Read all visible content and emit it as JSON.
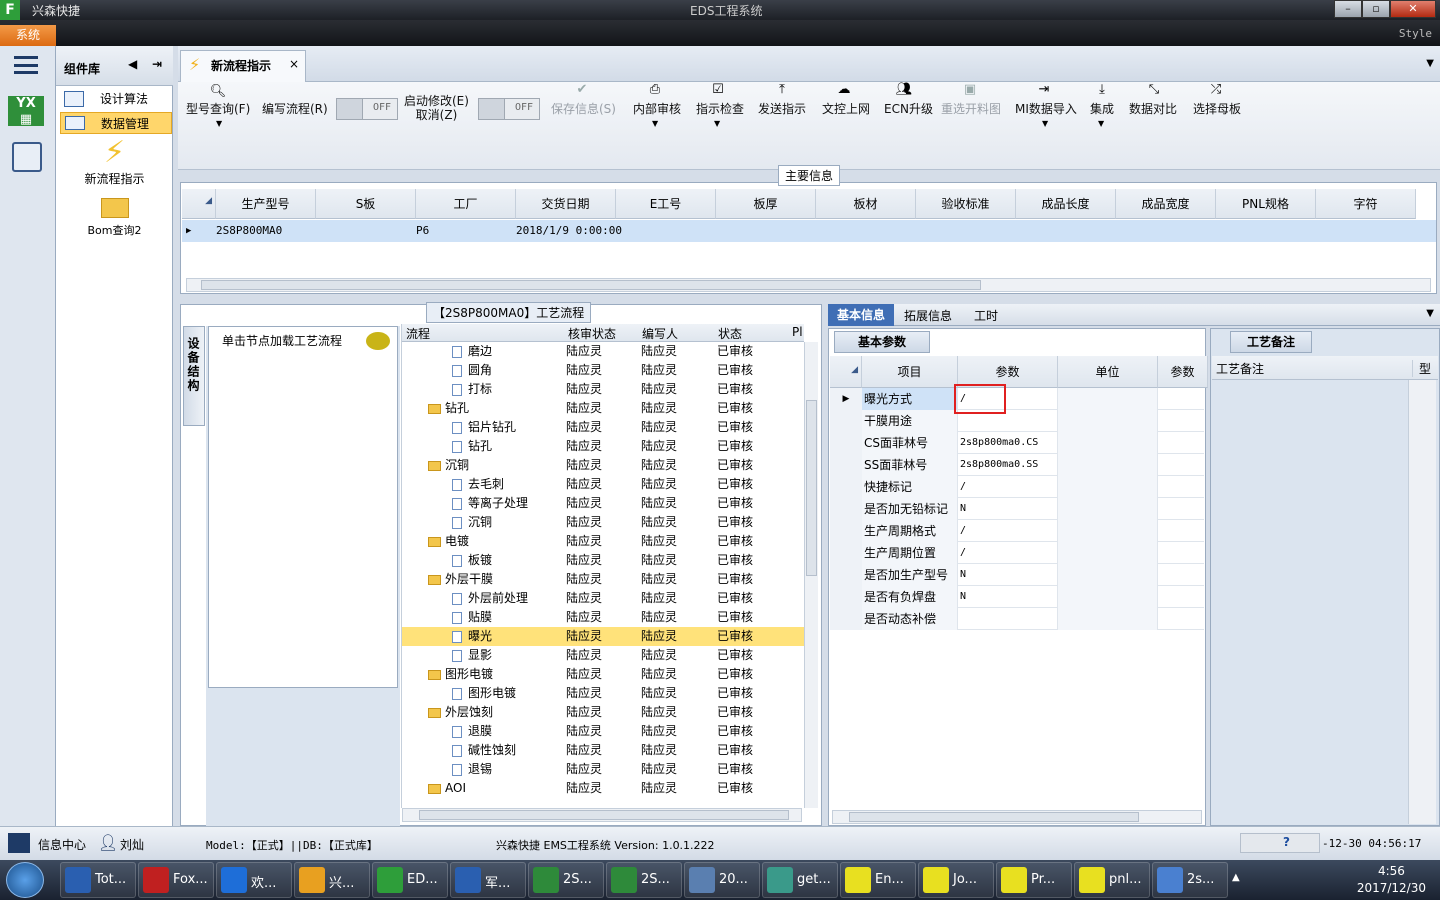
{
  "window": {
    "app_name": "兴森快捷",
    "title": "EDS工程系统",
    "logo": "F"
  },
  "menu": {
    "system": "系统",
    "style": "Style"
  },
  "component_panel": {
    "title": "组件库",
    "items": [
      {
        "label": "设计算法",
        "icon": "grid-icon"
      },
      {
        "label": "数据管理",
        "icon": "grid-icon",
        "selected": true
      },
      {
        "label": "新流程指示",
        "icon": "lightning-icon"
      },
      {
        "label": "Bom查询2",
        "icon": "folder-icon"
      }
    ]
  },
  "tab": {
    "label": "新流程指示"
  },
  "toolbar": {
    "query": "型号查询(F)",
    "write": "编写流程(R)",
    "toggle_off": "OFF",
    "start_edit_1": "启动修改(E)",
    "start_edit_2": "取消(Z)",
    "buttons": [
      {
        "label": "保存信息(S)",
        "icon": "check-icon",
        "disabled": true
      },
      {
        "label": "内部审核",
        "icon": "printer-icon"
      },
      {
        "label": "指示检查",
        "icon": "checkbox-icon"
      },
      {
        "label": "发送指示",
        "icon": "upload-icon"
      },
      {
        "label": "文控上网",
        "icon": "cloud-icon"
      },
      {
        "label": "ECN升级",
        "icon": "people-icon"
      },
      {
        "label": "重选开料图",
        "icon": "image-icon",
        "disabled": true
      },
      {
        "label": "MI数据导入",
        "icon": "import-icon"
      },
      {
        "label": "集成",
        "icon": "download-icon"
      },
      {
        "label": "数据对比",
        "icon": "compare-icon"
      },
      {
        "label": "选择母板",
        "icon": "shuffle-icon"
      }
    ]
  },
  "main_info": {
    "title": "主要信息",
    "columns": [
      "生产型号",
      "S板",
      "工厂",
      "交货日期",
      "E工号",
      "板厚",
      "板材",
      "验收标准",
      "成品长度",
      "成品宽度",
      "PNL规格",
      "字符"
    ],
    "row": {
      "model": "2S8P800MA0",
      "factory": "P6",
      "date": "2018/1/9 0:00:00"
    }
  },
  "process": {
    "title": "【2S8P800MA0】工艺流程",
    "side_tab": "设备结构",
    "hint": "单击节点加载工艺流程",
    "columns": [
      "流程",
      "核审状态",
      "编写人",
      "状态",
      "Pl"
    ],
    "rows": [
      {
        "name": "磨边",
        "type": "doc",
        "level": 2,
        "a": "陆应灵",
        "b": "陆应灵",
        "c": "已审核"
      },
      {
        "name": "圆角",
        "type": "doc",
        "level": 2,
        "a": "陆应灵",
        "b": "陆应灵",
        "c": "已审核"
      },
      {
        "name": "打标",
        "type": "doc",
        "level": 2,
        "a": "陆应灵",
        "b": "陆应灵",
        "c": "已审核"
      },
      {
        "name": "钻孔",
        "type": "folder",
        "level": 1,
        "a": "陆应灵",
        "b": "陆应灵",
        "c": "已审核"
      },
      {
        "name": "铝片钻孔",
        "type": "doc",
        "level": 2,
        "a": "陆应灵",
        "b": "陆应灵",
        "c": "已审核"
      },
      {
        "name": "钻孔",
        "type": "doc",
        "level": 2,
        "a": "陆应灵",
        "b": "陆应灵",
        "c": "已审核"
      },
      {
        "name": "沉铜",
        "type": "folder",
        "level": 1,
        "a": "陆应灵",
        "b": "陆应灵",
        "c": "已审核"
      },
      {
        "name": "去毛刺",
        "type": "doc",
        "level": 2,
        "a": "陆应灵",
        "b": "陆应灵",
        "c": "已审核"
      },
      {
        "name": "等离子处理",
        "type": "doc",
        "level": 2,
        "a": "陆应灵",
        "b": "陆应灵",
        "c": "已审核"
      },
      {
        "name": "沉铜",
        "type": "doc",
        "level": 2,
        "a": "陆应灵",
        "b": "陆应灵",
        "c": "已审核"
      },
      {
        "name": "电镀",
        "type": "folder",
        "level": 1,
        "a": "陆应灵",
        "b": "陆应灵",
        "c": "已审核"
      },
      {
        "name": "板镀",
        "type": "doc",
        "level": 2,
        "a": "陆应灵",
        "b": "陆应灵",
        "c": "已审核"
      },
      {
        "name": "外层干膜",
        "type": "folder",
        "level": 1,
        "a": "陆应灵",
        "b": "陆应灵",
        "c": "已审核"
      },
      {
        "name": "外层前处理",
        "type": "doc",
        "level": 2,
        "a": "陆应灵",
        "b": "陆应灵",
        "c": "已审核"
      },
      {
        "name": "贴膜",
        "type": "doc",
        "level": 2,
        "a": "陆应灵",
        "b": "陆应灵",
        "c": "已审核"
      },
      {
        "name": "曝光",
        "type": "doc",
        "level": 2,
        "a": "陆应灵",
        "b": "陆应灵",
        "c": "已审核",
        "selected": true
      },
      {
        "name": "显影",
        "type": "doc",
        "level": 2,
        "a": "陆应灵",
        "b": "陆应灵",
        "c": "已审核"
      },
      {
        "name": "图形电镀",
        "type": "folder",
        "level": 1,
        "a": "陆应灵",
        "b": "陆应灵",
        "c": "已审核"
      },
      {
        "name": "图形电镀",
        "type": "doc",
        "level": 2,
        "a": "陆应灵",
        "b": "陆应灵",
        "c": "已审核"
      },
      {
        "name": "外层蚀刻",
        "type": "folder",
        "level": 1,
        "a": "陆应灵",
        "b": "陆应灵",
        "c": "已审核"
      },
      {
        "name": "退膜",
        "type": "doc",
        "level": 2,
        "a": "陆应灵",
        "b": "陆应灵",
        "c": "已审核"
      },
      {
        "name": "碱性蚀刻",
        "type": "doc",
        "level": 2,
        "a": "陆应灵",
        "b": "陆应灵",
        "c": "已审核"
      },
      {
        "name": "退锡",
        "type": "doc",
        "level": 2,
        "a": "陆应灵",
        "b": "陆应灵",
        "c": "已审核"
      },
      {
        "name": "AOI",
        "type": "folder",
        "level": 1,
        "a": "陆应灵",
        "b": "陆应灵",
        "c": "已审核"
      }
    ]
  },
  "detail_tabs": [
    "基本信息",
    "拓展信息",
    "工时"
  ],
  "params": {
    "tab": "基本参数",
    "columns": [
      "项目",
      "参数",
      "单位",
      "参数"
    ],
    "rows": [
      {
        "item": "曝光方式",
        "value": "/"
      },
      {
        "item": "干膜用途",
        "value": ""
      },
      {
        "item": "CS面菲林号",
        "value": "2s8p800ma0.CS"
      },
      {
        "item": "SS面菲林号",
        "value": "2s8p800ma0.SS"
      },
      {
        "item": "快捷标记",
        "value": "/"
      },
      {
        "item": "是否加无铅标记",
        "value": "N"
      },
      {
        "item": "生产周期格式",
        "value": "/"
      },
      {
        "item": "生产周期位置",
        "value": "/"
      },
      {
        "item": "是否加生产型号",
        "value": "N"
      },
      {
        "item": "是否有负焊盘",
        "value": "N"
      },
      {
        "item": "是否动态补偿",
        "value": ""
      }
    ]
  },
  "remarks": {
    "tab": "工艺备注",
    "col1": "工艺备注",
    "col2": "型"
  },
  "status": {
    "info_center": "信息中心",
    "user": "刘灿",
    "model": "Model:【正式】||DB:【正式库】",
    "version": "兴森快捷 EMS工程系统 Version: 1.0.1.222",
    "time": "-12-30 04:56:17"
  },
  "taskbar": {
    "items": [
      "Tot...",
      "Fox...",
      "欢...",
      "兴...",
      "ED...",
      "军...",
      "2S...",
      "2S...",
      "20...",
      "get...",
      "En...",
      "Jo...",
      "Pr...",
      "pnl...",
      "2s..."
    ],
    "clock_time": "4:56",
    "clock_date": "2017/12/30"
  }
}
